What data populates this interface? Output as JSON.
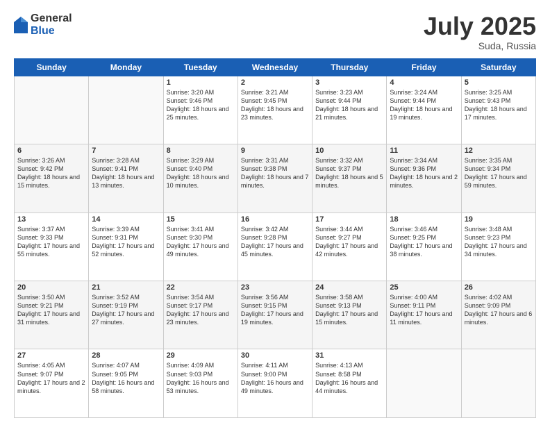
{
  "header": {
    "logo_general": "General",
    "logo_blue": "Blue",
    "month_title": "July 2025",
    "location": "Suda, Russia"
  },
  "days_of_week": [
    "Sunday",
    "Monday",
    "Tuesday",
    "Wednesday",
    "Thursday",
    "Friday",
    "Saturday"
  ],
  "weeks": [
    [
      {
        "day": "",
        "info": ""
      },
      {
        "day": "",
        "info": ""
      },
      {
        "day": "1",
        "info": "Sunrise: 3:20 AM\nSunset: 9:46 PM\nDaylight: 18 hours\nand 25 minutes."
      },
      {
        "day": "2",
        "info": "Sunrise: 3:21 AM\nSunset: 9:45 PM\nDaylight: 18 hours\nand 23 minutes."
      },
      {
        "day": "3",
        "info": "Sunrise: 3:23 AM\nSunset: 9:44 PM\nDaylight: 18 hours\nand 21 minutes."
      },
      {
        "day": "4",
        "info": "Sunrise: 3:24 AM\nSunset: 9:44 PM\nDaylight: 18 hours\nand 19 minutes."
      },
      {
        "day": "5",
        "info": "Sunrise: 3:25 AM\nSunset: 9:43 PM\nDaylight: 18 hours\nand 17 minutes."
      }
    ],
    [
      {
        "day": "6",
        "info": "Sunrise: 3:26 AM\nSunset: 9:42 PM\nDaylight: 18 hours\nand 15 minutes."
      },
      {
        "day": "7",
        "info": "Sunrise: 3:28 AM\nSunset: 9:41 PM\nDaylight: 18 hours\nand 13 minutes."
      },
      {
        "day": "8",
        "info": "Sunrise: 3:29 AM\nSunset: 9:40 PM\nDaylight: 18 hours\nand 10 minutes."
      },
      {
        "day": "9",
        "info": "Sunrise: 3:31 AM\nSunset: 9:38 PM\nDaylight: 18 hours\nand 7 minutes."
      },
      {
        "day": "10",
        "info": "Sunrise: 3:32 AM\nSunset: 9:37 PM\nDaylight: 18 hours\nand 5 minutes."
      },
      {
        "day": "11",
        "info": "Sunrise: 3:34 AM\nSunset: 9:36 PM\nDaylight: 18 hours\nand 2 minutes."
      },
      {
        "day": "12",
        "info": "Sunrise: 3:35 AM\nSunset: 9:34 PM\nDaylight: 17 hours\nand 59 minutes."
      }
    ],
    [
      {
        "day": "13",
        "info": "Sunrise: 3:37 AM\nSunset: 9:33 PM\nDaylight: 17 hours\nand 55 minutes."
      },
      {
        "day": "14",
        "info": "Sunrise: 3:39 AM\nSunset: 9:31 PM\nDaylight: 17 hours\nand 52 minutes."
      },
      {
        "day": "15",
        "info": "Sunrise: 3:41 AM\nSunset: 9:30 PM\nDaylight: 17 hours\nand 49 minutes."
      },
      {
        "day": "16",
        "info": "Sunrise: 3:42 AM\nSunset: 9:28 PM\nDaylight: 17 hours\nand 45 minutes."
      },
      {
        "day": "17",
        "info": "Sunrise: 3:44 AM\nSunset: 9:27 PM\nDaylight: 17 hours\nand 42 minutes."
      },
      {
        "day": "18",
        "info": "Sunrise: 3:46 AM\nSunset: 9:25 PM\nDaylight: 17 hours\nand 38 minutes."
      },
      {
        "day": "19",
        "info": "Sunrise: 3:48 AM\nSunset: 9:23 PM\nDaylight: 17 hours\nand 34 minutes."
      }
    ],
    [
      {
        "day": "20",
        "info": "Sunrise: 3:50 AM\nSunset: 9:21 PM\nDaylight: 17 hours\nand 31 minutes."
      },
      {
        "day": "21",
        "info": "Sunrise: 3:52 AM\nSunset: 9:19 PM\nDaylight: 17 hours\nand 27 minutes."
      },
      {
        "day": "22",
        "info": "Sunrise: 3:54 AM\nSunset: 9:17 PM\nDaylight: 17 hours\nand 23 minutes."
      },
      {
        "day": "23",
        "info": "Sunrise: 3:56 AM\nSunset: 9:15 PM\nDaylight: 17 hours\nand 19 minutes."
      },
      {
        "day": "24",
        "info": "Sunrise: 3:58 AM\nSunset: 9:13 PM\nDaylight: 17 hours\nand 15 minutes."
      },
      {
        "day": "25",
        "info": "Sunrise: 4:00 AM\nSunset: 9:11 PM\nDaylight: 17 hours\nand 11 minutes."
      },
      {
        "day": "26",
        "info": "Sunrise: 4:02 AM\nSunset: 9:09 PM\nDaylight: 17 hours\nand 6 minutes."
      }
    ],
    [
      {
        "day": "27",
        "info": "Sunrise: 4:05 AM\nSunset: 9:07 PM\nDaylight: 17 hours\nand 2 minutes."
      },
      {
        "day": "28",
        "info": "Sunrise: 4:07 AM\nSunset: 9:05 PM\nDaylight: 16 hours\nand 58 minutes."
      },
      {
        "day": "29",
        "info": "Sunrise: 4:09 AM\nSunset: 9:03 PM\nDaylight: 16 hours\nand 53 minutes."
      },
      {
        "day": "30",
        "info": "Sunrise: 4:11 AM\nSunset: 9:00 PM\nDaylight: 16 hours\nand 49 minutes."
      },
      {
        "day": "31",
        "info": "Sunrise: 4:13 AM\nSunset: 8:58 PM\nDaylight: 16 hours\nand 44 minutes."
      },
      {
        "day": "",
        "info": ""
      },
      {
        "day": "",
        "info": ""
      }
    ]
  ]
}
